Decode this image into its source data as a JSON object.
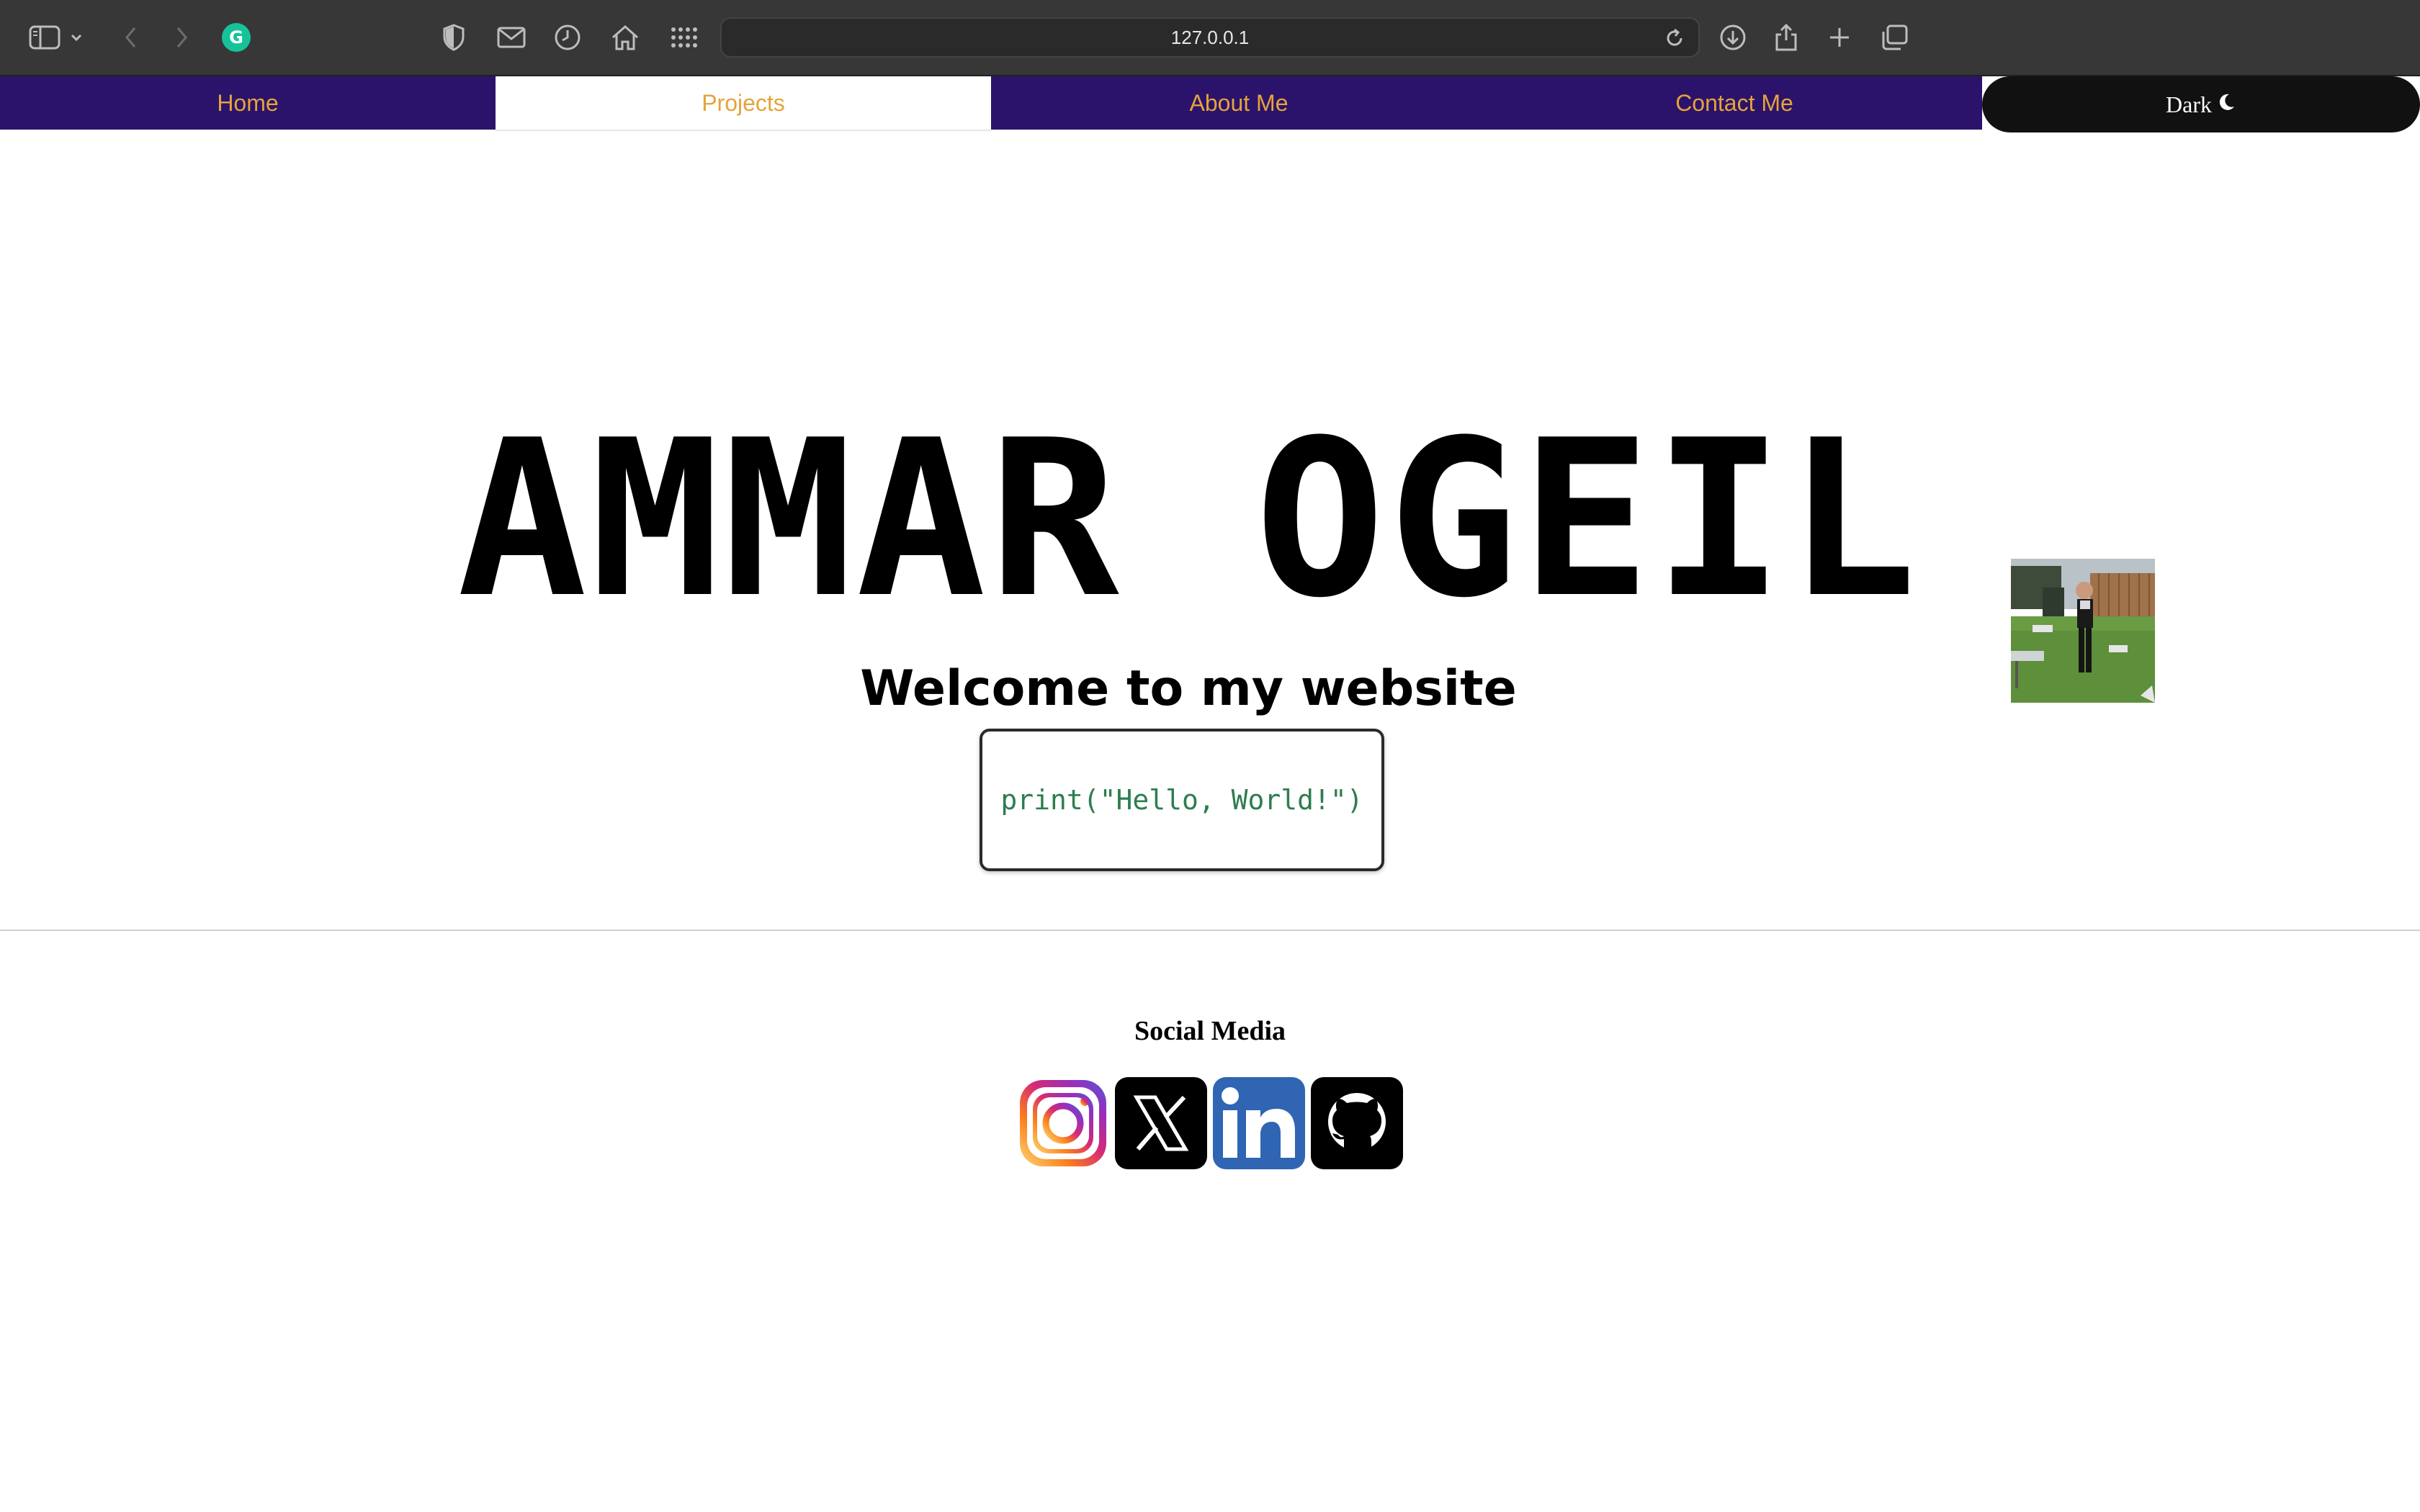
{
  "browser": {
    "url": "127.0.0.1",
    "icons": [
      "sidebar-icon",
      "chevron-down-icon",
      "back-arrow-icon",
      "forward-arrow-icon",
      "grammarly-icon",
      "shield-icon",
      "mail-icon",
      "history-clock-icon",
      "home-icon",
      "grid-apps-icon",
      "reload-icon",
      "download-icon",
      "share-icon",
      "new-tab-plus-icon",
      "tab-overview-icon"
    ]
  },
  "nav": {
    "items": [
      {
        "label": "Home",
        "active": false
      },
      {
        "label": "Projects",
        "active": true
      },
      {
        "label": "About Me",
        "active": false
      },
      {
        "label": "Contact Me",
        "active": false
      }
    ],
    "theme_toggle": {
      "label": "Dark",
      "icon": "moon-icon"
    }
  },
  "hero": {
    "name": "AMMAR OGEIL",
    "subtitle": "Welcome to my website",
    "code": "print(\"Hello, World!\")",
    "photo_icon": "profile-photo"
  },
  "social": {
    "heading": "Social Media",
    "icons": [
      "instagram-icon",
      "x-twitter-icon",
      "linkedin-icon",
      "github-icon"
    ]
  },
  "colors": {
    "nav_bg": "#2b136b",
    "nav_text": "#e5a33a",
    "chrome_bg": "#373737",
    "code_text": "#2e7d4f",
    "theme_btn_bg": "#111111"
  }
}
